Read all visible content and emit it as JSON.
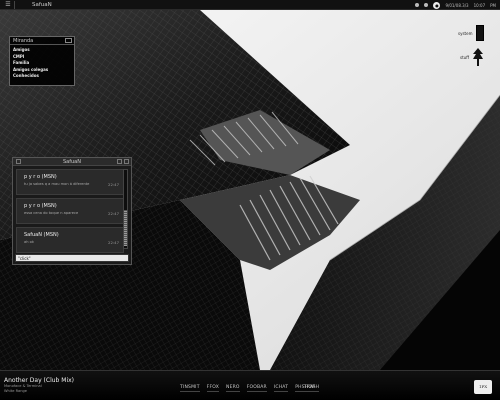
{
  "topbar": {
    "app_name": "SafuaN",
    "date": "9/01/08.3/3",
    "time": "10:07",
    "period": "PM"
  },
  "contacts": {
    "title": "Miranda",
    "groups": [
      "Amigos",
      "CMPI",
      "Familia",
      "Amigos colegas",
      "Conhecidos"
    ]
  },
  "chat": {
    "title": "SafuaN",
    "messages": [
      {
        "sender": "p y r o (MSN)",
        "text": "tu ja sabes q a mau mon á diferente",
        "time": "22:47"
      },
      {
        "sender": "p y r o (MSN)",
        "text": "essa cena do toque n aparece",
        "time": "22:47"
      },
      {
        "sender": "SafuaN (MSN)",
        "text": "ah ok",
        "time": "22:47"
      }
    ],
    "input_value": "\"click\""
  },
  "desktop_icons": [
    {
      "label": "system",
      "icon": "drive-icon"
    },
    {
      "label": "stuff",
      "icon": "tree-icon"
    }
  ],
  "now_playing": {
    "title": "Another Day (Club Mix)",
    "artist": "Monoface & Terminal",
    "album": "White Range"
  },
  "dock": {
    "items": [
      "TINSMIT",
      "FFOX",
      "NERO",
      "FOOBAR",
      "ICHAT",
      "PHSHOP"
    ],
    "trash": "TRASH"
  },
  "logo_text": "1PX",
  "colors": {
    "sky": "#e6e6e6",
    "building_dark": "#0d0d0d",
    "accent": "#eeeeee"
  }
}
